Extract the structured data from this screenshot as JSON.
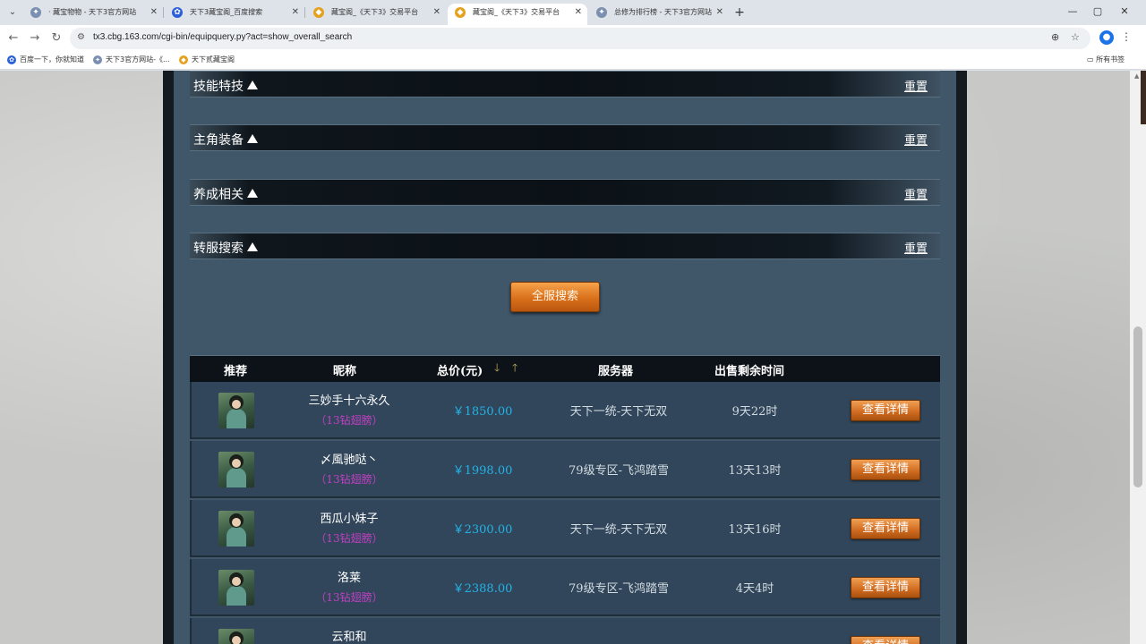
{
  "browser": {
    "tabs": [
      {
        "title": "· 藏宝物物 - 天下3官方网站"
      },
      {
        "title": "天下3藏宝阁_百度搜索"
      },
      {
        "title": "藏宝阁_《天下3》交易平台"
      },
      {
        "title": "藏宝阁_《天下3》交易平台"
      },
      {
        "title": "总修为排行榜 - 天下3官方网站"
      }
    ],
    "url": "tx3.cbg.163.com/cgi-bin/equipquery.py?act=show_overall_search",
    "bookmarks": [
      {
        "label": "百度一下，你就知道"
      },
      {
        "label": "天下3官方网站-《..."
      },
      {
        "label": "天下贰藏宝阁"
      }
    ],
    "bookmarks_folder": "所有书签"
  },
  "sections": [
    {
      "title": "技能特技",
      "reset": "重置"
    },
    {
      "title": "主角装备",
      "reset": "重置"
    },
    {
      "title": "养成相关",
      "reset": "重置"
    },
    {
      "title": "转服搜索",
      "reset": "重置"
    }
  ],
  "search_button": "全服搜索",
  "table": {
    "headers": {
      "recommend": "推荐",
      "nickname": "昵称",
      "price": "总价(元)",
      "server": "服务器",
      "remaining": "出售剩余时间"
    },
    "rows": [
      {
        "nickname": "三妙手十六永久",
        "tag": "（13钻翅膀）",
        "price": "￥1850.00",
        "server": "天下一统-天下无双",
        "remaining": "9天22时",
        "action": "查看详情"
      },
      {
        "nickname": "〆風驰哒丶",
        "tag": "（13钻翅膀）",
        "price": "￥1998.00",
        "server": "79级专区-飞鸿踏雪",
        "remaining": "13天13时",
        "action": "查看详情"
      },
      {
        "nickname": "西瓜小妹子",
        "tag": "（13钻翅膀）",
        "price": "￥2300.00",
        "server": "天下一统-天下无双",
        "remaining": "13天16时",
        "action": "查看详情"
      },
      {
        "nickname": "洛莱",
        "tag": "（13钻翅膀）",
        "price": "￥2388.00",
        "server": "79级专区-飞鸿踏雪",
        "remaining": "4天4时",
        "action": "查看详情"
      },
      {
        "nickname": "云和和",
        "tag": "",
        "price": "",
        "server": "",
        "remaining": "",
        "action": "查看详情"
      }
    ]
  },
  "colors": {
    "price": "#22b3e6",
    "tag": "#c23fc4",
    "button_orange": "#d9701b"
  }
}
